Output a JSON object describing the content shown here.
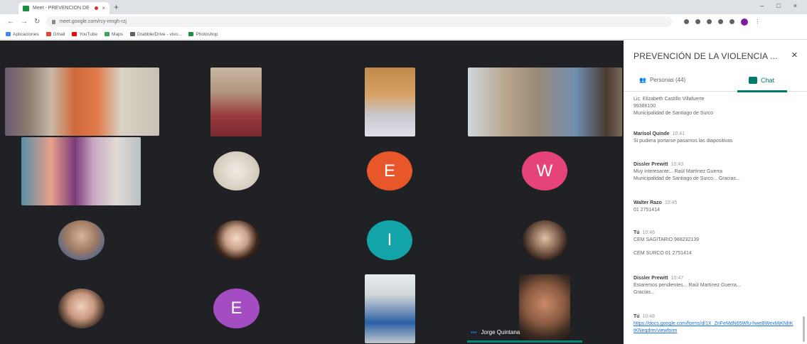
{
  "browser": {
    "tab_title": "Meet - PREVENCIÓN DE LA",
    "tab_close": "×",
    "new_tab": "+",
    "window_controls": [
      "–",
      "□",
      "×"
    ],
    "url": "meet.google.com/rcy-mngh-rzj",
    "bookmarks": [
      {
        "label": "Aplicaciones",
        "color": "#4285f4"
      },
      {
        "label": "Gmail",
        "color": "#ea4335"
      },
      {
        "label": "YouTube",
        "color": "#ff0000"
      },
      {
        "label": "Maps",
        "color": "#34a853"
      },
      {
        "label": "Drabble/Drive - vivo...",
        "color": "#5f6368"
      },
      {
        "label": "Photoshop",
        "color": "#1e8e3e"
      }
    ]
  },
  "panel": {
    "title": "PREVENCIÓN DE LA VIOLENCIA ...",
    "close": "×",
    "tab_people": "Personas (44)",
    "tab_chat": "Chat",
    "messages": [
      {
        "sender": "",
        "time": "",
        "lines": [
          "Lic. Elizabeth Castillo Villafuerte",
          "99386100",
          "Municipalidad de Santiago de Surco"
        ]
      },
      {
        "sender": "Marisol Quinde",
        "time": "10:41",
        "lines": [
          "Si pudiera portarse pasarnos las diapositivas"
        ]
      },
      {
        "sender": "Dissler Prewitt",
        "time": "10:43",
        "lines": [
          "Muy interesante... Raúl Martínez Guerra",
          "Municipalidad de Santiago de Surco... Gracias..."
        ]
      },
      {
        "sender": "Walter Razo",
        "time": "10:45",
        "lines": [
          "01 2751414"
        ]
      },
      {
        "sender": "Tú",
        "time": "10:46",
        "lines": [
          "CEM SAGITARIO 988232139",
          "",
          "CEM SURCO 01 2751414"
        ]
      },
      {
        "sender": "Dissler Prewitt",
        "time": "10:47",
        "lines": [
          "Estaremos pendientes... Raúl Martínez Guerra...",
          "Gracias..."
        ]
      },
      {
        "sender": "Tú",
        "time": "10:48",
        "link": "https://docs.google.com/forms/d/1X_ZnFeMdN65Wfu-hweBWexMjKNhKtKNeqdrm/viewform"
      }
    ]
  },
  "participants": {
    "letters": [
      {
        "letter": "E",
        "color": "#e8572a"
      },
      {
        "letter": "W",
        "color": "#e64479"
      },
      {
        "letter": "I",
        "color": "#12a4a8"
      },
      {
        "letter": "E",
        "color": "#a44dc3"
      }
    ],
    "active_speaker": "Jorge Quintana"
  }
}
